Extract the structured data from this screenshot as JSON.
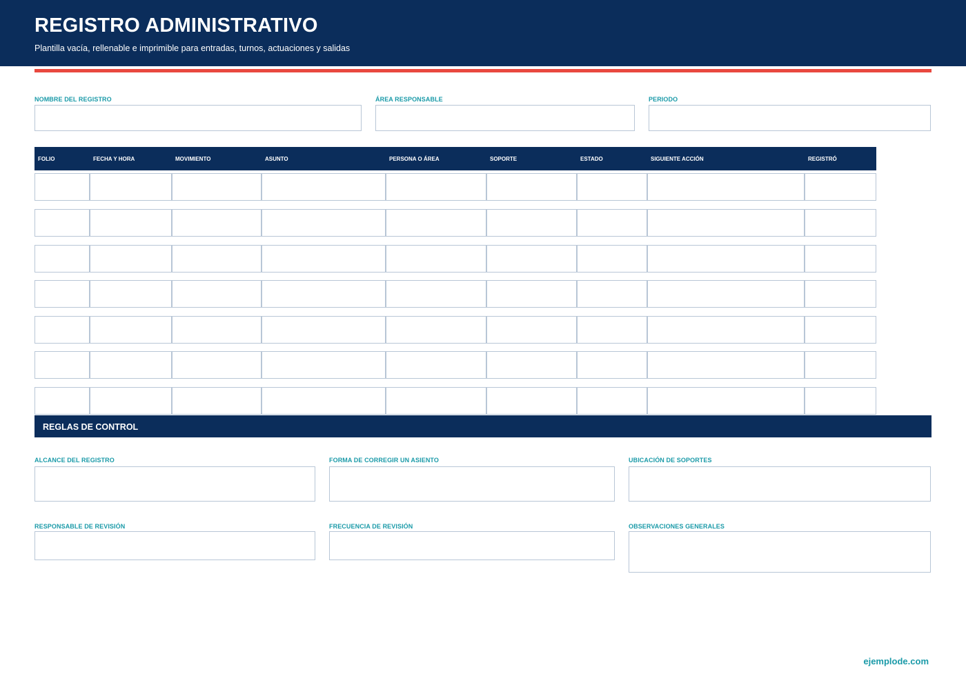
{
  "header": {
    "title": "REGISTRO ADMINISTRATIVO",
    "subtitle": "Plantilla vacía, rellenable e imprimible para entradas, turnos, actuaciones y salidas"
  },
  "top_fields": [
    {
      "label": "NOMBRE DEL REGISTRO",
      "value": ""
    },
    {
      "label": "ÁREA RESPONSABLE",
      "value": ""
    },
    {
      "label": "PERIODO",
      "value": ""
    }
  ],
  "table": {
    "columns": [
      "FOLIO",
      "FECHA Y HORA",
      "MOVIMIENTO",
      "ASUNTO",
      "PERSONA O ÁREA",
      "SOPORTE",
      "ESTADO",
      "SIGUIENTE ACCIÓN",
      "REGISTRÓ"
    ],
    "rows": [
      [
        "",
        "",
        "",
        "",
        "",
        "",
        "",
        "",
        ""
      ],
      [
        "",
        "",
        "",
        "",
        "",
        "",
        "",
        "",
        ""
      ],
      [
        "",
        "",
        "",
        "",
        "",
        "",
        "",
        "",
        ""
      ],
      [
        "",
        "",
        "",
        "",
        "",
        "",
        "",
        "",
        ""
      ],
      [
        "",
        "",
        "",
        "",
        "",
        "",
        "",
        "",
        ""
      ],
      [
        "",
        "",
        "",
        "",
        "",
        "",
        "",
        "",
        ""
      ],
      [
        "",
        "",
        "",
        "",
        "",
        "",
        "",
        "",
        ""
      ]
    ]
  },
  "control_section": {
    "title": "REGLAS DE CONTROL",
    "fields": [
      {
        "label": "ALCANCE DEL REGISTRO",
        "value": ""
      },
      {
        "label": "FORMA DE CORREGIR UN ASIENTO",
        "value": ""
      },
      {
        "label": "UBICACIÓN DE SOPORTES",
        "value": ""
      },
      {
        "label": "RESPONSABLE DE REVISIÓN",
        "value": ""
      },
      {
        "label": "FRECUENCIA DE REVISIÓN",
        "value": ""
      },
      {
        "label": "OBSERVACIONES GENERALES",
        "value": ""
      }
    ]
  },
  "footer": {
    "brand": "ejemplode.com"
  },
  "colors": {
    "navy": "#0b2d5b",
    "accent_red": "#e9483f",
    "teal": "#1a9aa8",
    "border": "#b8c6d6"
  }
}
